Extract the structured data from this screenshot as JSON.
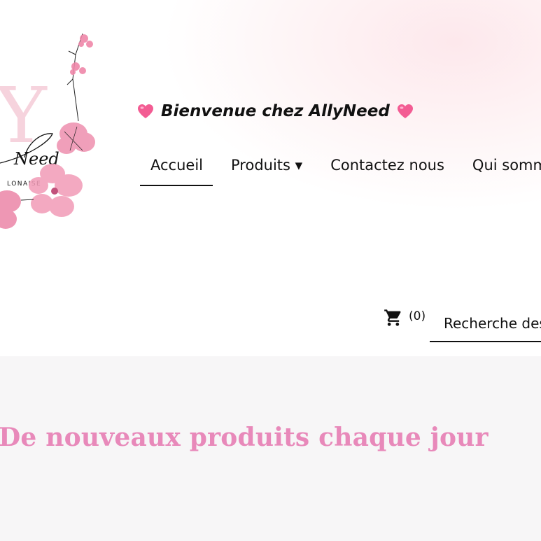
{
  "header": {
    "logo": {
      "letter": "Y",
      "script_text": "Need",
      "subtitle_text": "LONAISE",
      "brand_color": "#f0b6c6"
    },
    "welcome_text": "Bienvenue chez AllyNeed",
    "heart_color": "#f35c93",
    "nav": [
      {
        "label": "Accueil",
        "active": true
      },
      {
        "label": "Produits ▾",
        "active": false
      },
      {
        "label": "Contactez nous",
        "active": false
      },
      {
        "label": "Qui sommes nous",
        "active": false
      }
    ],
    "cart": {
      "icon": "cart-icon",
      "count": "(0)"
    },
    "search": {
      "placeholder": "Recherche des produits"
    }
  },
  "main": {
    "headline": "De nouveaux produits chaque jour",
    "headline_color": "#e889ba"
  }
}
